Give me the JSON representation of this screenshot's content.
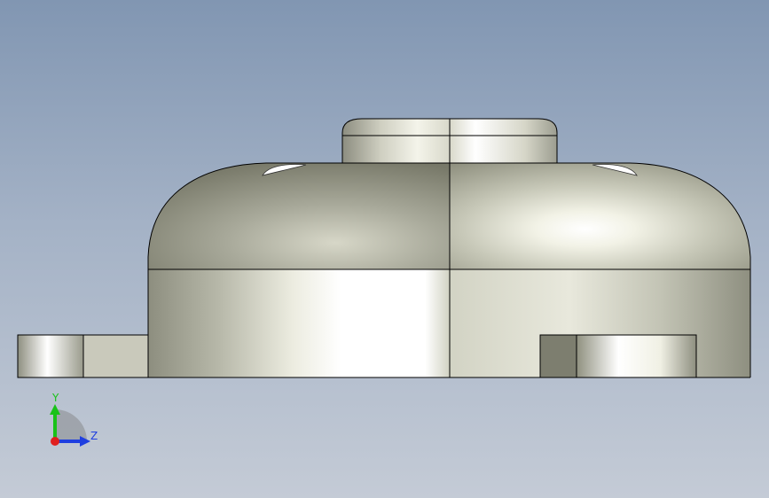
{
  "orientation_triad": {
    "axis_y_label": "Y",
    "axis_z_label": "Z",
    "colors": {
      "y_axis": "#19c219",
      "z_axis": "#1f3fe0",
      "x_axis": "#e01f1f"
    }
  },
  "scene": {
    "background_top": "#8196b2",
    "background_bottom": "#c4cbd6",
    "part_color": "#c9c9b9"
  }
}
